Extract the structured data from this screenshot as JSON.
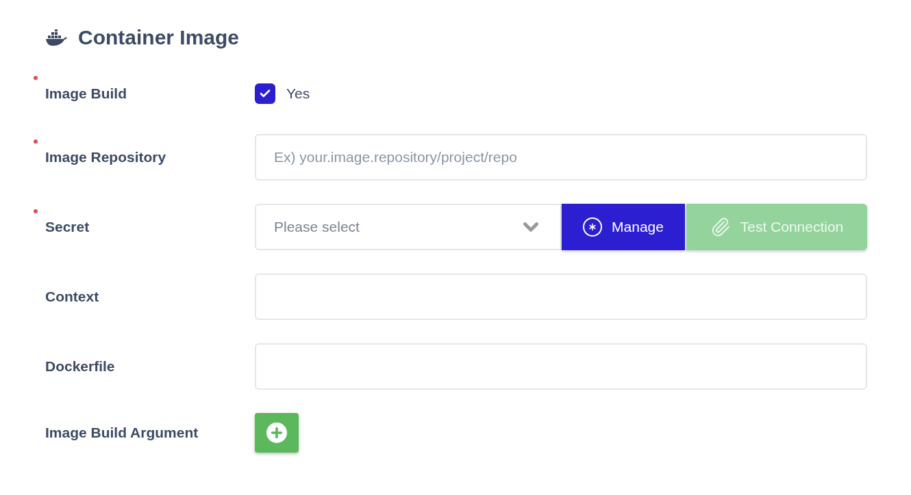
{
  "section": {
    "title": "Container Image"
  },
  "fields": [
    {
      "kind": "checkbox",
      "label": "Image Build",
      "required": true,
      "checked": true,
      "option": "Yes"
    },
    {
      "kind": "text",
      "label": "Image Repository",
      "required": true,
      "placeholder": "Ex) your.image.repository/project/repo"
    },
    {
      "kind": "select",
      "label": "Secret",
      "required": true,
      "placeholder": "Please select",
      "buttons": [
        {
          "kind": "manage",
          "label": "Manage",
          "disabled": false
        },
        {
          "kind": "test",
          "label": "Test Connection",
          "disabled": true
        }
      ]
    },
    {
      "kind": "text",
      "label": "Context",
      "required": false
    },
    {
      "kind": "text",
      "label": "Dockerfile",
      "required": false
    },
    {
      "kind": "add",
      "label": "Image Build Argument",
      "required": false
    }
  ]
}
